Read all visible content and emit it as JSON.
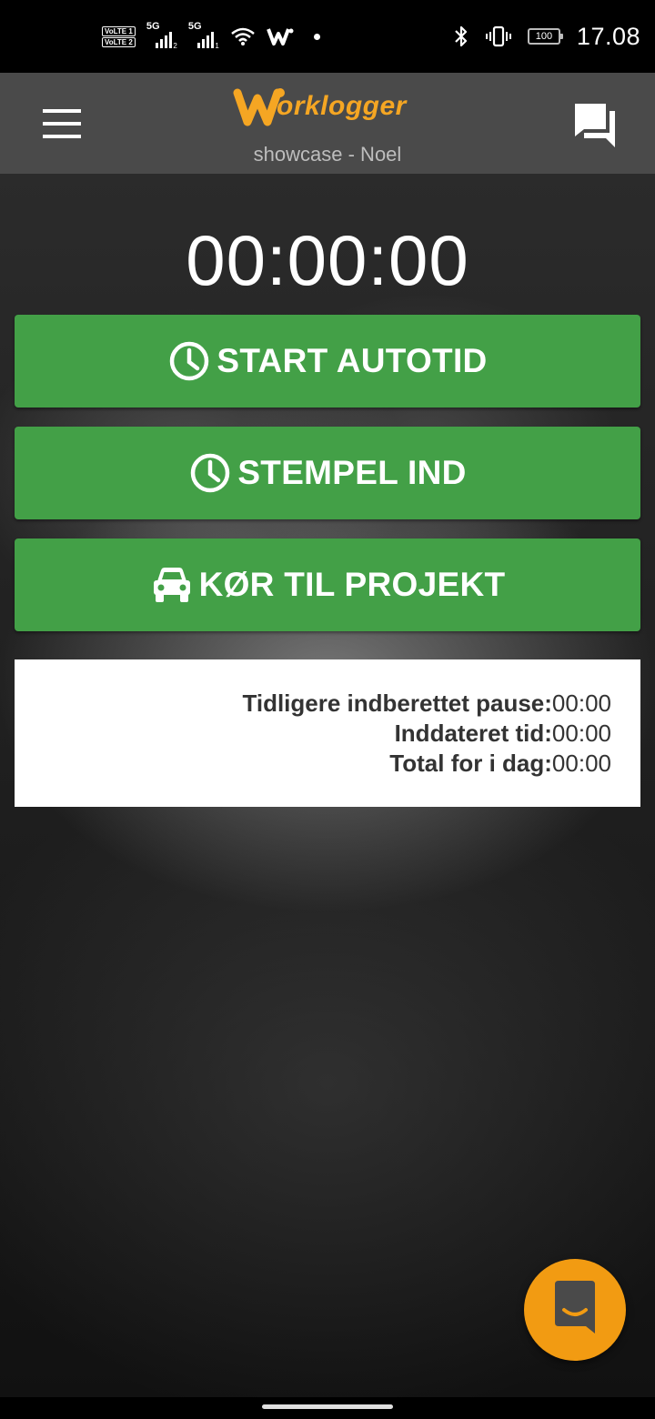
{
  "status_bar": {
    "volte_1": "VoLTE 1",
    "volte_2": "VoLTE 2",
    "sim1_network": "5G",
    "sim1_index": "2",
    "sim2_network": "5G",
    "sim2_index": "1",
    "battery_level": "100",
    "time": "17.08",
    "icons": [
      "wifi-icon",
      "worklogger-notification-icon",
      "bluetooth-icon",
      "vibrate-icon",
      "battery-icon"
    ]
  },
  "header": {
    "logo_text": "orklogger",
    "subtitle": "showcase - Noel",
    "brand_color": "#f5a623"
  },
  "timer": "00:00:00",
  "actions": {
    "start_autotid": "START AUTOTID",
    "stempel_ind": "STEMPEL IND",
    "kor_til_projekt": "KØR TIL PROJEKT",
    "button_color": "#43a047"
  },
  "summary": {
    "previous_pause_label": "Tidligere indberettet pause:",
    "previous_pause_value": "00:00",
    "entered_time_label": "Inddateret tid:",
    "entered_time_value": "00:00",
    "total_today_label": "Total for i dag:",
    "total_today_value": "00:00"
  },
  "fab": {
    "color": "#f29b12",
    "icon": "chat-launcher-icon"
  }
}
